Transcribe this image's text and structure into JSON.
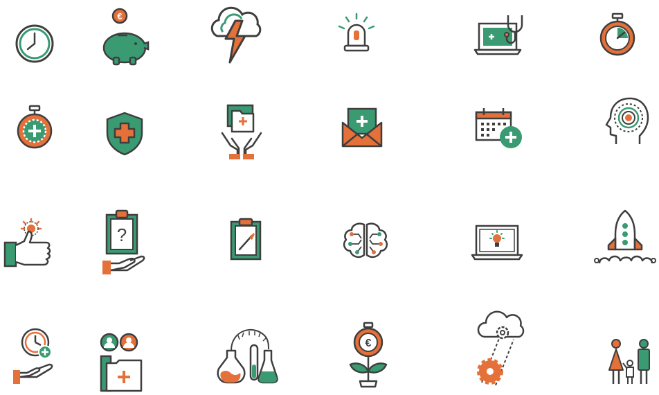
{
  "palette": {
    "teal": "#3a9b73",
    "orange": "#e4703a",
    "outline": "#3e3e3e",
    "light": "#ffffff"
  },
  "icons": [
    "clock-icon",
    "piggy-bank-euro-icon",
    "storm-cloud-icon",
    "alarm-light-icon",
    "laptop-stethoscope-icon",
    "stopwatch-icon",
    "medical-stopwatch-icon",
    "medical-shield-icon",
    "hands-medical-folder-icon",
    "medical-envelope-icon",
    "calendar-add-icon",
    "head-target-icon",
    "thumbs-up-icon",
    "clipboard-question-hand-icon",
    "clipboard-scalpel-icon",
    "brain-network-icon",
    "laptop-lightbulb-icon",
    "rocket-launch-icon",
    "clock-hand-icon",
    "team-folder-icon",
    "lab-flasks-icon",
    "money-flower-icon",
    "cloud-gears-icon",
    "family-icon"
  ],
  "labels": {
    "coin_symbol": "€",
    "question_symbol": "?"
  }
}
